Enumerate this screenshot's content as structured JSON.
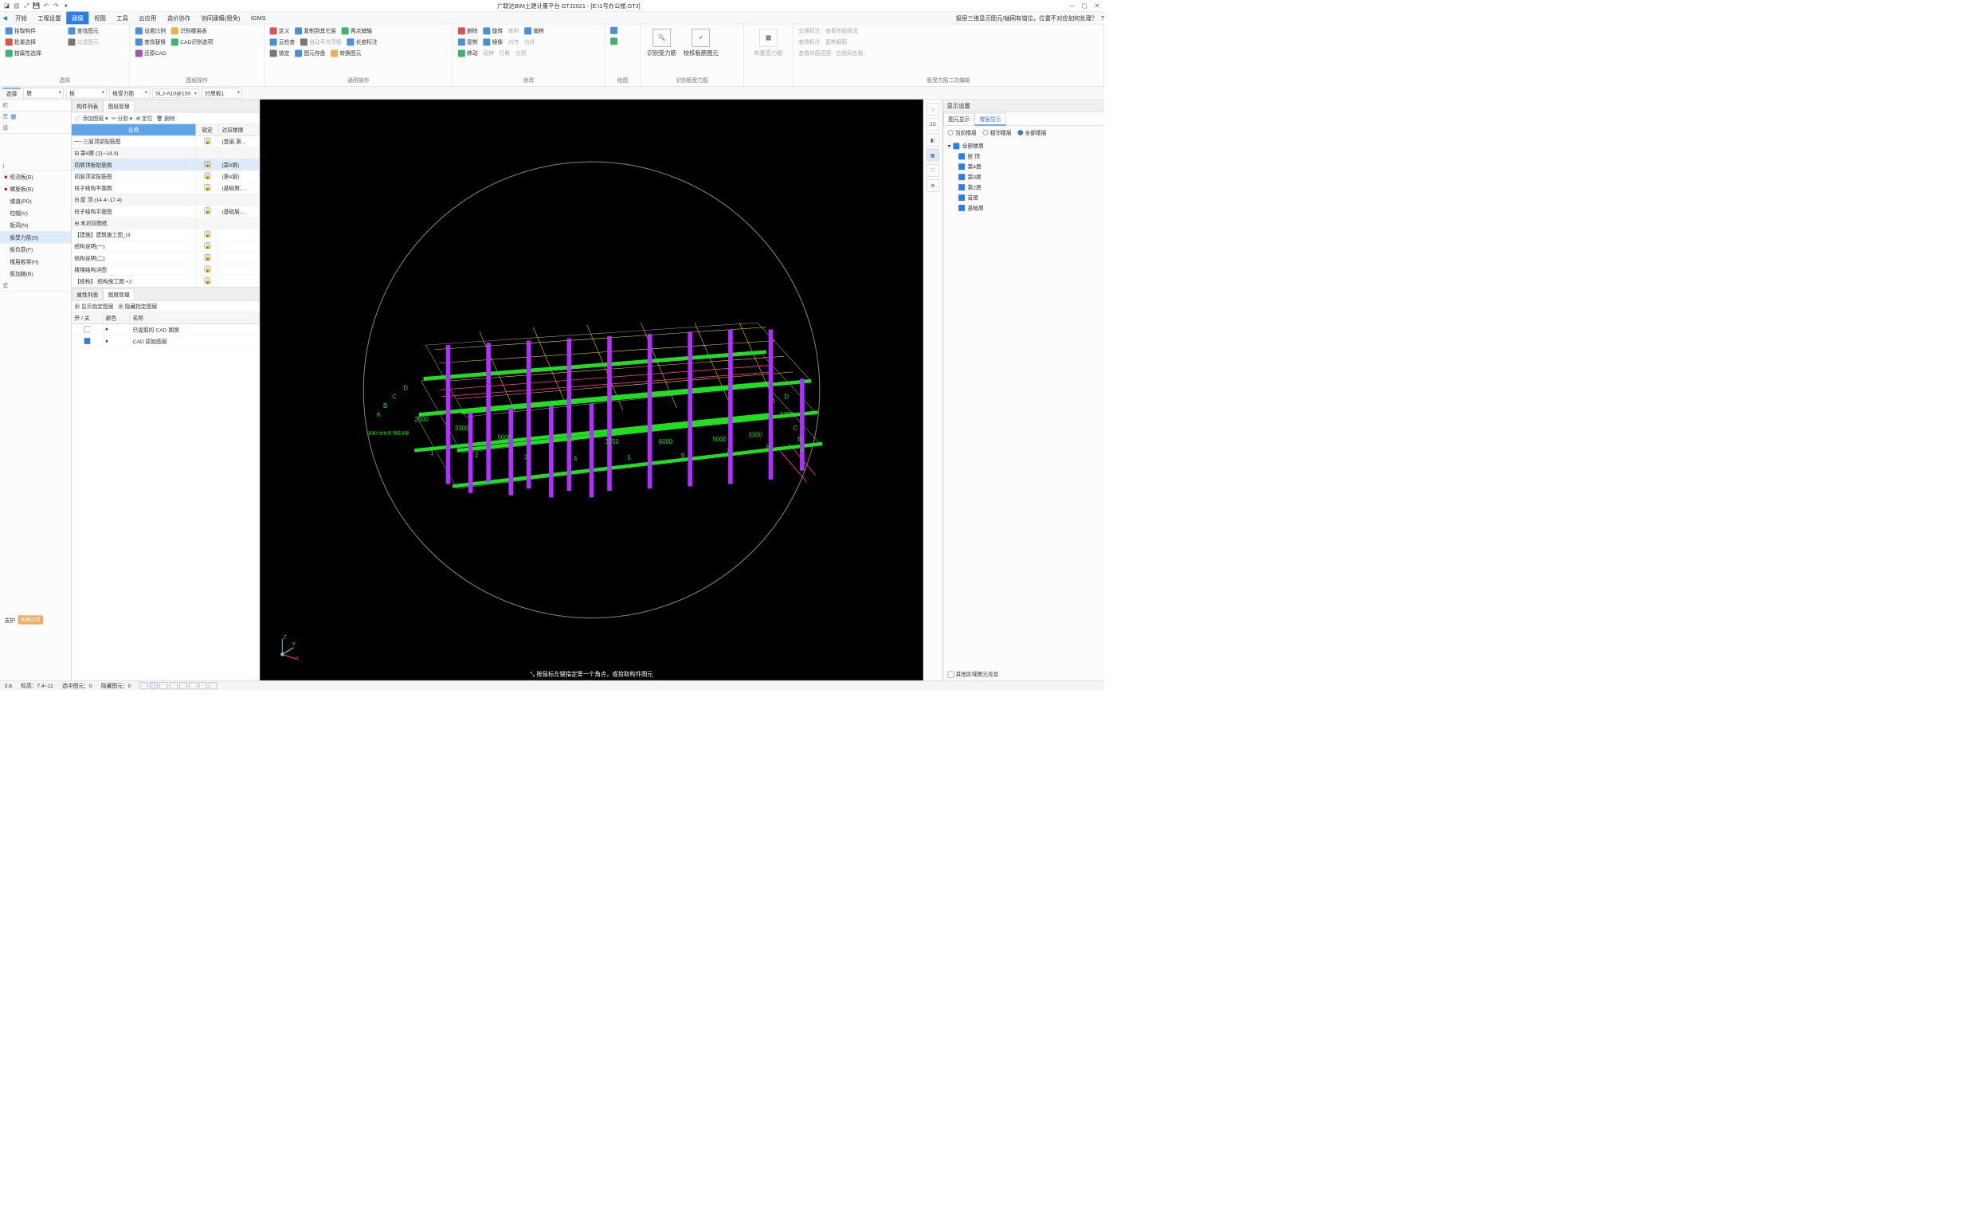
{
  "title": "广联达BIM土建计量平台 GTJ2021 - [E:\\1号办公楼.GTJ]",
  "hint_top": "㚫层三维显示图元/轴网有错位，位置不对应如何处理？",
  "menus": [
    "开始",
    "工程设置",
    "建模",
    "视图",
    "工具",
    "云应用",
    "造价协作",
    "协同建模(限免)",
    "IGMS"
  ],
  "menu_active": 2,
  "ribbon": {
    "g1": {
      "label": "选择",
      "items": [
        "拾取构件",
        "批量选择",
        "按属性选择",
        "查找图元",
        "过滤图元"
      ]
    },
    "g2": {
      "label": "图纸操作",
      "items": [
        "设置比例",
        "查找替换",
        "还原CAD",
        "识别楼层表",
        "CAD识别选项"
      ]
    },
    "g3": {
      "items": [
        "定义",
        "云检查",
        "锁定",
        "复制到其它层",
        "自动平齐顶板",
        "图元存盘",
        "两点辅轴",
        "长度标注",
        "转换图元"
      ],
      "label": "通用操作"
    },
    "g4": {
      "label": "修改",
      "items": [
        "删除",
        "复制",
        "移动",
        "旋转",
        "镜像",
        "延伸",
        "修剪",
        "对齐",
        "打断",
        "偏移",
        "合并",
        "分割"
      ]
    },
    "g5": {
      "label": "绘图"
    },
    "g6": {
      "label": "识别板受力筋",
      "items": [
        "识别受力筋",
        "校核板筋图元"
      ]
    },
    "g7": {
      "label": "",
      "items": [
        "布置受力筋"
      ]
    },
    "g8": {
      "label": "板受力筋二次编辑",
      "items": [
        "交换标注",
        "查看布筋情况",
        "查改标注",
        "复制钢筋",
        "查看布筋范围",
        "应用同名板"
      ]
    }
  },
  "selrow": {
    "tab": "选择",
    "s1": "层",
    "s2": "板",
    "s3": "板受力筋",
    "s4": "SLJ-A10@150",
    "s5": "分层板1"
  },
  "left": {
    "hdr": "栏",
    "items": [
      "现浇板(B)",
      "螺旋板(B)",
      "坡道(PD)",
      "柱帽(V)",
      "板洞(N)",
      "板受力筋(S)",
      "板负筋(F)",
      "楼层板带(H)",
      "板加腋(B)"
    ],
    "sel": 5,
    "sec": "式",
    "sup": "支护",
    "try": "免费试用"
  },
  "panel": {
    "tabs": [
      "构件列表",
      "图纸管理"
    ],
    "tabActive": 1,
    "tools": [
      "添加图纸",
      "分割",
      "定位",
      "删除"
    ],
    "cols": [
      "名称",
      "锁定",
      "对应楼层"
    ],
    "rows": [
      {
        "t": 0,
        "name": "一~三层顶梁配筋图",
        "lock": true,
        "layer": "(首层,第..."
      },
      {
        "t": 1,
        "name": "第4层 (11~14.4)"
      },
      {
        "t": 2,
        "name": "四层顶板配筋图",
        "lock": true,
        "layer": "(第4层)",
        "sel": true
      },
      {
        "t": 2,
        "name": "四层顶梁配筋图",
        "lock": true,
        "layer": "(第4层)"
      },
      {
        "t": 2,
        "name": "柱子结构平面图",
        "lock": true,
        "layer": "(基础层,..."
      },
      {
        "t": 1,
        "name": "屋 顶 (14.4~17.4)"
      },
      {
        "t": 2,
        "name": "柱子结构平面图",
        "lock": true,
        "layer": "(基础层,..."
      },
      {
        "t": 1,
        "name": "未对应图纸"
      },
      {
        "t": 2,
        "name": "【建施】建筑施工图_t3",
        "lock": true
      },
      {
        "t": 2,
        "name": "结构说明(一)",
        "lock": true
      },
      {
        "t": 2,
        "name": "结构说明(二)",
        "lock": true
      },
      {
        "t": 2,
        "name": "楼梯结构详图",
        "lock": true
      },
      {
        "t": 2,
        "name": "【结构】 结构施工图 +2",
        "lock": true
      }
    ]
  },
  "panel2": {
    "tabs": [
      "属性列表",
      "图层管理"
    ],
    "tabActive": 1,
    "tools": [
      "显示指定图层",
      "隐藏指定图层"
    ],
    "cols": [
      "开 / 关",
      "颜色",
      "名称"
    ],
    "rows": [
      {
        "on": false,
        "name": "已提取的 CAD 图层"
      },
      {
        "on": true,
        "name": "CAD 原始图层"
      }
    ]
  },
  "vhint": "⤡ 按鼠标左键指定第一个角点，或拾取构件图元",
  "vtools": [
    "○",
    "2D",
    "◧",
    "▦",
    "⛶",
    "⚙"
  ],
  "right": {
    "hdr": "显示设置",
    "subtabs": [
      "图元显示",
      "楼层显示"
    ],
    "subActive": 1,
    "radios": [
      "当前楼层",
      "相邻楼层",
      "全部楼层"
    ],
    "radioSel": 2,
    "tree": [
      "全部楼层",
      "屋 顶",
      "第4层",
      "第3层",
      "第2层",
      "首层",
      "基础层"
    ],
    "bot": "其他区域图元亮显"
  },
  "status": {
    "s1": "3.6",
    "s2": "标高：7.4~11",
    "s3": "选中图元：0",
    "s4": "隐藏图元：0"
  }
}
